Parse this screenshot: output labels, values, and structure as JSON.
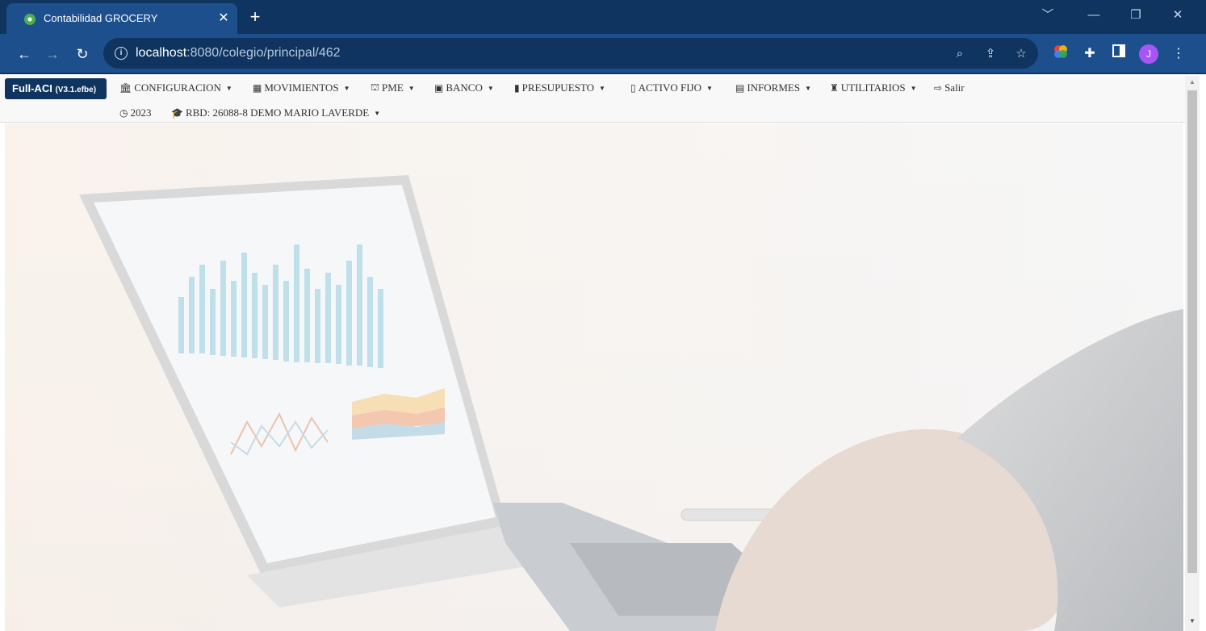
{
  "browser": {
    "tab_title": "Contabilidad GROCERY",
    "tab_close": "✕",
    "new_tab": "+",
    "url_host": "localhost",
    "url_rest": ":8080/colegio/principal/462",
    "avatar_initial": "J",
    "window_controls": [
      "﹀",
      "—",
      "❐",
      "✕"
    ],
    "favicon_color": "#4caf50",
    "chrome_color": "#1d4f8c"
  },
  "app": {
    "brand": "Full-ACI",
    "version": "(V3.1.efbe)",
    "menu": [
      {
        "icon": "bank-icon",
        "glyph": "🏛",
        "label": "CONFIGURACION"
      },
      {
        "icon": "table-icon",
        "glyph": "▦",
        "label": "MOVIMIENTOS"
      },
      {
        "icon": "sitemap-icon",
        "glyph": "⛫",
        "label": "PME"
      },
      {
        "icon": "money-icon",
        "glyph": "▣",
        "label": "BANCO"
      },
      {
        "icon": "briefcase-icon",
        "glyph": "▮",
        "label": "PRESUPUESTO"
      },
      {
        "icon": "building-icon",
        "glyph": "▯",
        "label": "ACTIVO FIJO"
      },
      {
        "icon": "file-icon",
        "glyph": "▤",
        "label": "INFORMES"
      },
      {
        "icon": "tools-icon",
        "glyph": "♜",
        "label": "UTILITARIOS"
      },
      {
        "icon": "logout-icon",
        "glyph": "⇨",
        "label": "Salir"
      }
    ],
    "year": "2023",
    "school": "RBD: 26088-8 DEMO MARIO LAVERDE"
  }
}
